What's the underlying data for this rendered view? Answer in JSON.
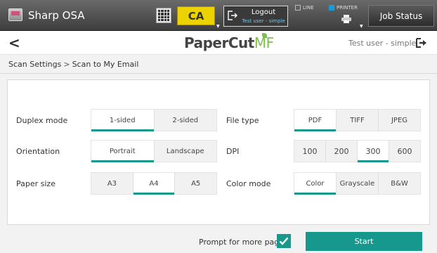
{
  "device": {
    "name": "Sharp OSA",
    "ca_label": "CA"
  },
  "logout": {
    "label": "Logout",
    "user": "Test user - simple"
  },
  "indicators": {
    "line": "LINE",
    "printer": "PRINTER"
  },
  "job_status": {
    "label": "Job Status"
  },
  "header": {
    "back": "<",
    "brand_main": "PaperCut",
    "brand_mf": "MF",
    "user": "Test user - simple"
  },
  "breadcrumb": {
    "parent": "Scan Settings",
    "separator": ">",
    "current": "Scan to My Email"
  },
  "settings": {
    "duplex": {
      "label": "Duplex mode",
      "options": [
        "1-sided",
        "2-sided"
      ],
      "selected": 0
    },
    "orientation": {
      "label": "Orientation",
      "options": [
        "Portrait",
        "Landscape"
      ],
      "selected": 0
    },
    "paper_size": {
      "label": "Paper size",
      "options": [
        "A3",
        "A4",
        "A5"
      ],
      "selected": 1
    },
    "file_type": {
      "label": "File type",
      "options": [
        "PDF",
        "TIFF",
        "JPEG"
      ],
      "selected": 0
    },
    "dpi": {
      "label": "DPI",
      "options": [
        "100",
        "200",
        "300",
        "600"
      ],
      "selected": 2
    },
    "color_mode": {
      "label": "Color mode",
      "options": [
        "Color",
        "Grayscale",
        "B&W"
      ],
      "selected": 0
    }
  },
  "footer": {
    "prompt_label": "Prompt for more pages",
    "prompt_checked": true,
    "start_label": "Start"
  },
  "colors": {
    "accent": "#16998c",
    "ca_yellow": "#ecd200",
    "brand_green": "#7bc04a",
    "printer_blue": "#1a9bd7"
  }
}
